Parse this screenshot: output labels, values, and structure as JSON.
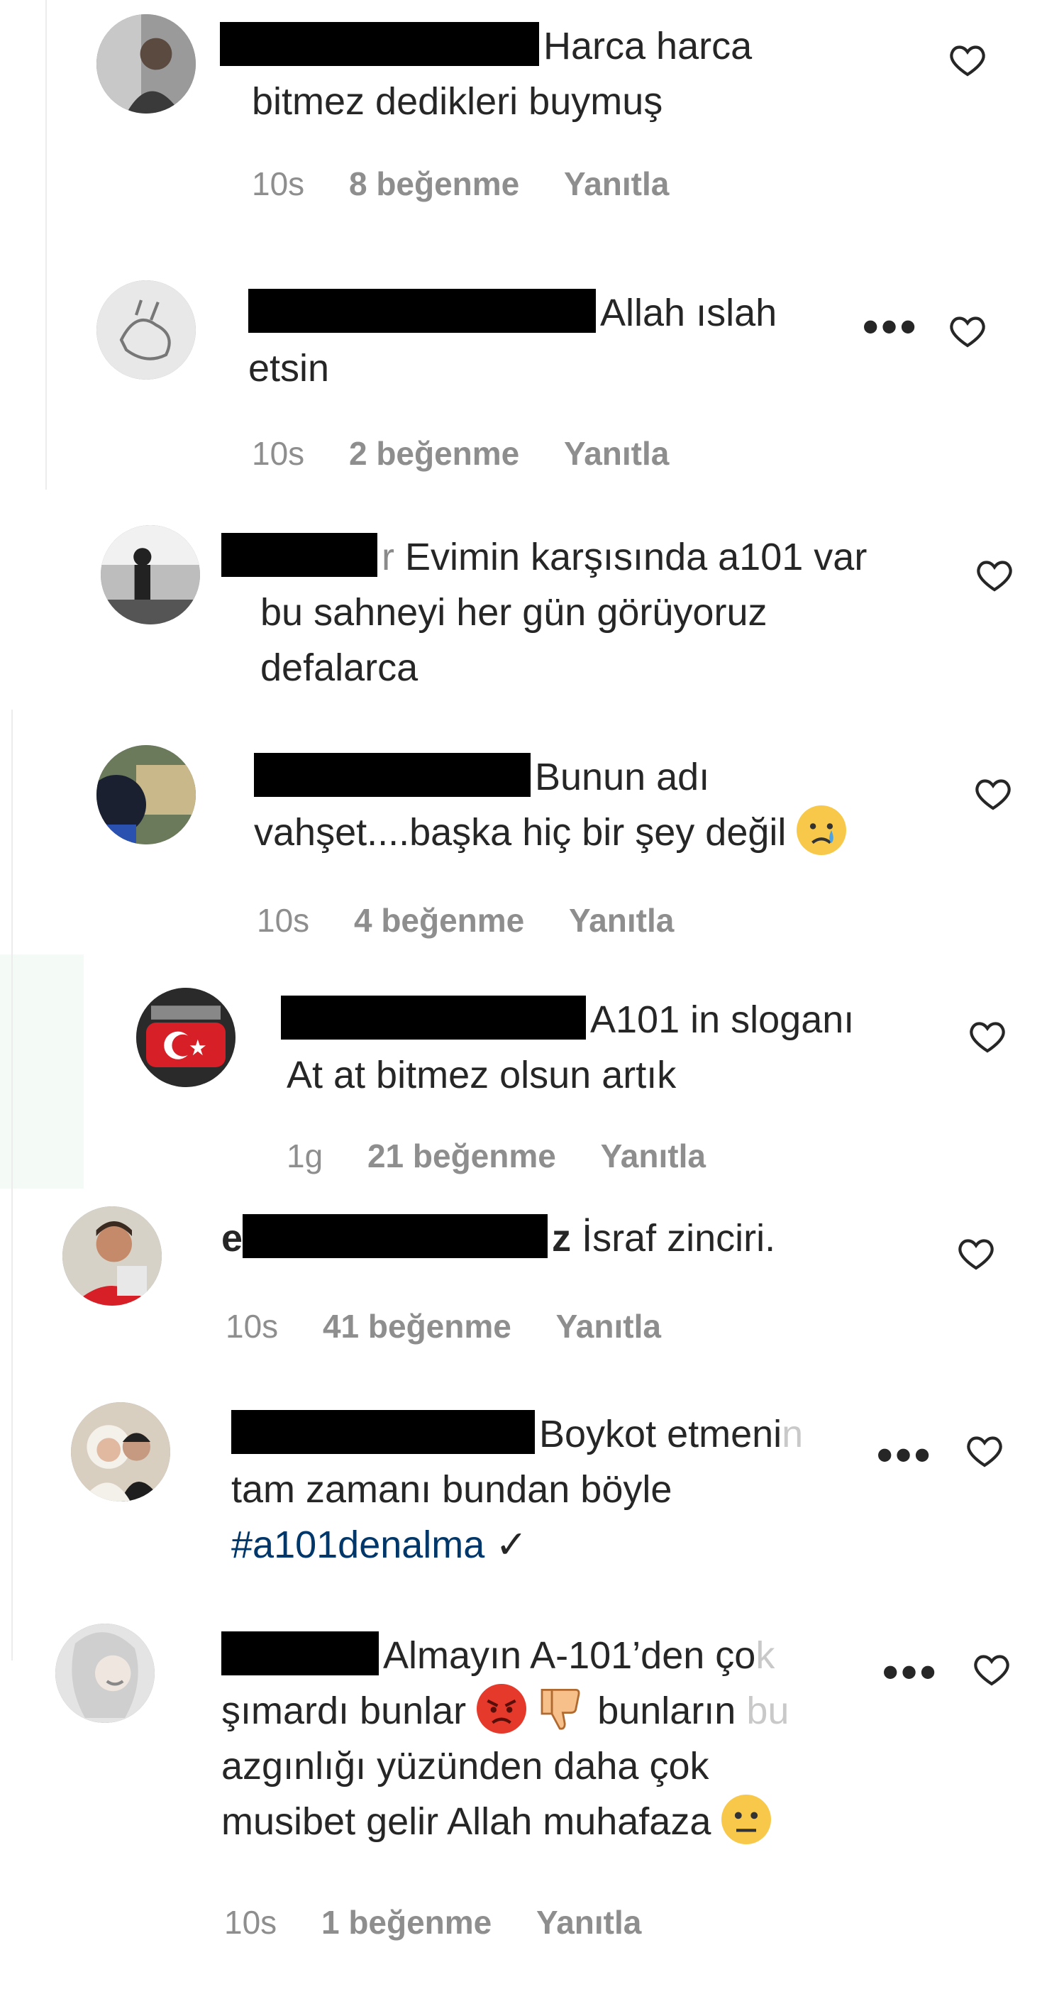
{
  "comments": [
    {
      "text": "Harca harca",
      "text2": "bitmez dedikleri buymuş",
      "time": "10s",
      "likes": "8 beğenme",
      "reply": "Yanıtla"
    },
    {
      "text": "Allah ıslah",
      "text2": "etsin",
      "time": "10s",
      "likes": "2 beğenme",
      "reply": "Yanıtla"
    },
    {
      "text": "Evimin karşısında a101 var",
      "text2": "bu sahneyi her gün görüyoruz",
      "text3": "defalarca"
    },
    {
      "text": "Bunun adı",
      "text2": "vahşet....başka hiç bir şey değil",
      "time": "10s",
      "likes": "4 beğenme",
      "reply": "Yanıtla"
    },
    {
      "text": "A101 in sloganı",
      "text2": "At at bitmez olsun artık",
      "time": "1g",
      "likes": "21 beğenme",
      "reply": "Yanıtla"
    },
    {
      "text": "İsraf zinciri.",
      "time": "10s",
      "likes": "41 beğenme",
      "reply": "Yanıtla"
    },
    {
      "text": "Boykot etmeni",
      "text_faded": "n",
      "text2": "tam zamanı bundan böyle",
      "hashtag": "#a101denalma",
      "hashtag_suffix": " ✓"
    },
    {
      "text": "Almayın A-101’den ço",
      "text_faded": "k",
      "text2": "şımardı bunlar",
      "text2b": " bunların ",
      "text2_faded": "bu",
      "text3": "azgınlığı yüzünden daha çok",
      "text4": "musibet gelir Allah muhafaza",
      "time": "10s",
      "likes": "1 beğenme",
      "reply": "Yanıtla"
    }
  ],
  "icons": {
    "like": "heart-outline-icon",
    "more": "more-options-icon",
    "emoji_sad": "sad-tear-emoji",
    "emoji_angry": "angry-face-emoji",
    "emoji_thumbs_down": "thumbs-down-emoji",
    "emoji_neutral": "neutral-face-emoji"
  },
  "colors": {
    "text": "#262626",
    "meta": "#8e8e8e",
    "hashtag": "#00376b",
    "redaction": "#000000"
  }
}
